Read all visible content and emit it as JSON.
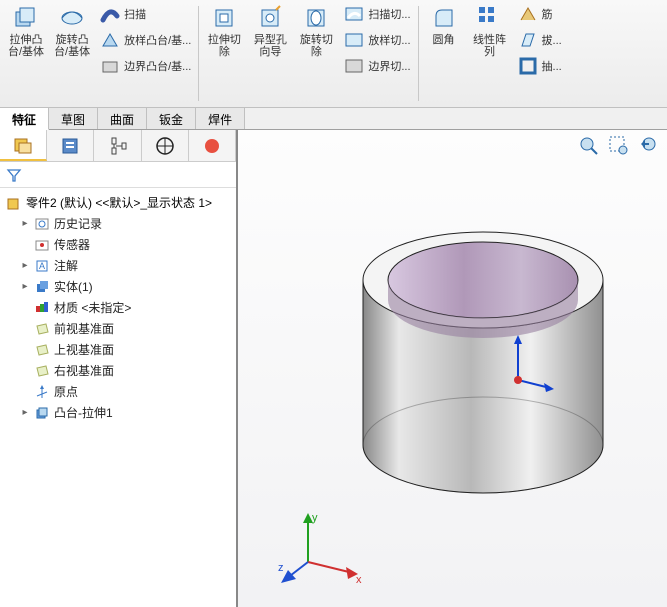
{
  "ribbon": {
    "g1": {
      "extrude": "拉伸凸\n台/基体",
      "revolve": "旋转凸\n台/基体",
      "sweep": "扫描",
      "loft": "放样凸台/基...",
      "boundary": "边界凸台/基..."
    },
    "g2": {
      "extrudeCut": "拉伸切\n除",
      "holeWizard": "异型孔\n向导",
      "revolveCut": "旋转切\n除",
      "sweepCut": "扫描切...",
      "loftCut": "放样切...",
      "boundaryCut": "边界切..."
    },
    "g3": {
      "fillet": "圆角",
      "linearPattern": "线性阵\n列",
      "rib": "筋",
      "draft": "拔...",
      "shell": "抽..."
    }
  },
  "tabs": [
    "特征",
    "草图",
    "曲面",
    "钣金",
    "焊件"
  ],
  "activeTab": 0,
  "tree": {
    "root": "零件2 (默认) <<默认>_显示状态 1>",
    "items": [
      {
        "label": "历史记录",
        "icon": "history",
        "exp": "▸"
      },
      {
        "label": "传感器",
        "icon": "sensor",
        "exp": ""
      },
      {
        "label": "注解",
        "icon": "annot",
        "exp": "▸"
      },
      {
        "label": "实体(1)",
        "icon": "solid",
        "exp": "▸"
      },
      {
        "label": "材质 <未指定>",
        "icon": "material",
        "exp": ""
      },
      {
        "label": "前视基准面",
        "icon": "plane",
        "exp": ""
      },
      {
        "label": "上视基准面",
        "icon": "plane",
        "exp": ""
      },
      {
        "label": "右视基准面",
        "icon": "plane",
        "exp": ""
      },
      {
        "label": "原点",
        "icon": "origin",
        "exp": ""
      },
      {
        "label": "凸台-拉伸1",
        "icon": "extrude",
        "exp": "▸"
      }
    ]
  },
  "triad": {
    "x": "x",
    "y": "y",
    "z": "z"
  }
}
